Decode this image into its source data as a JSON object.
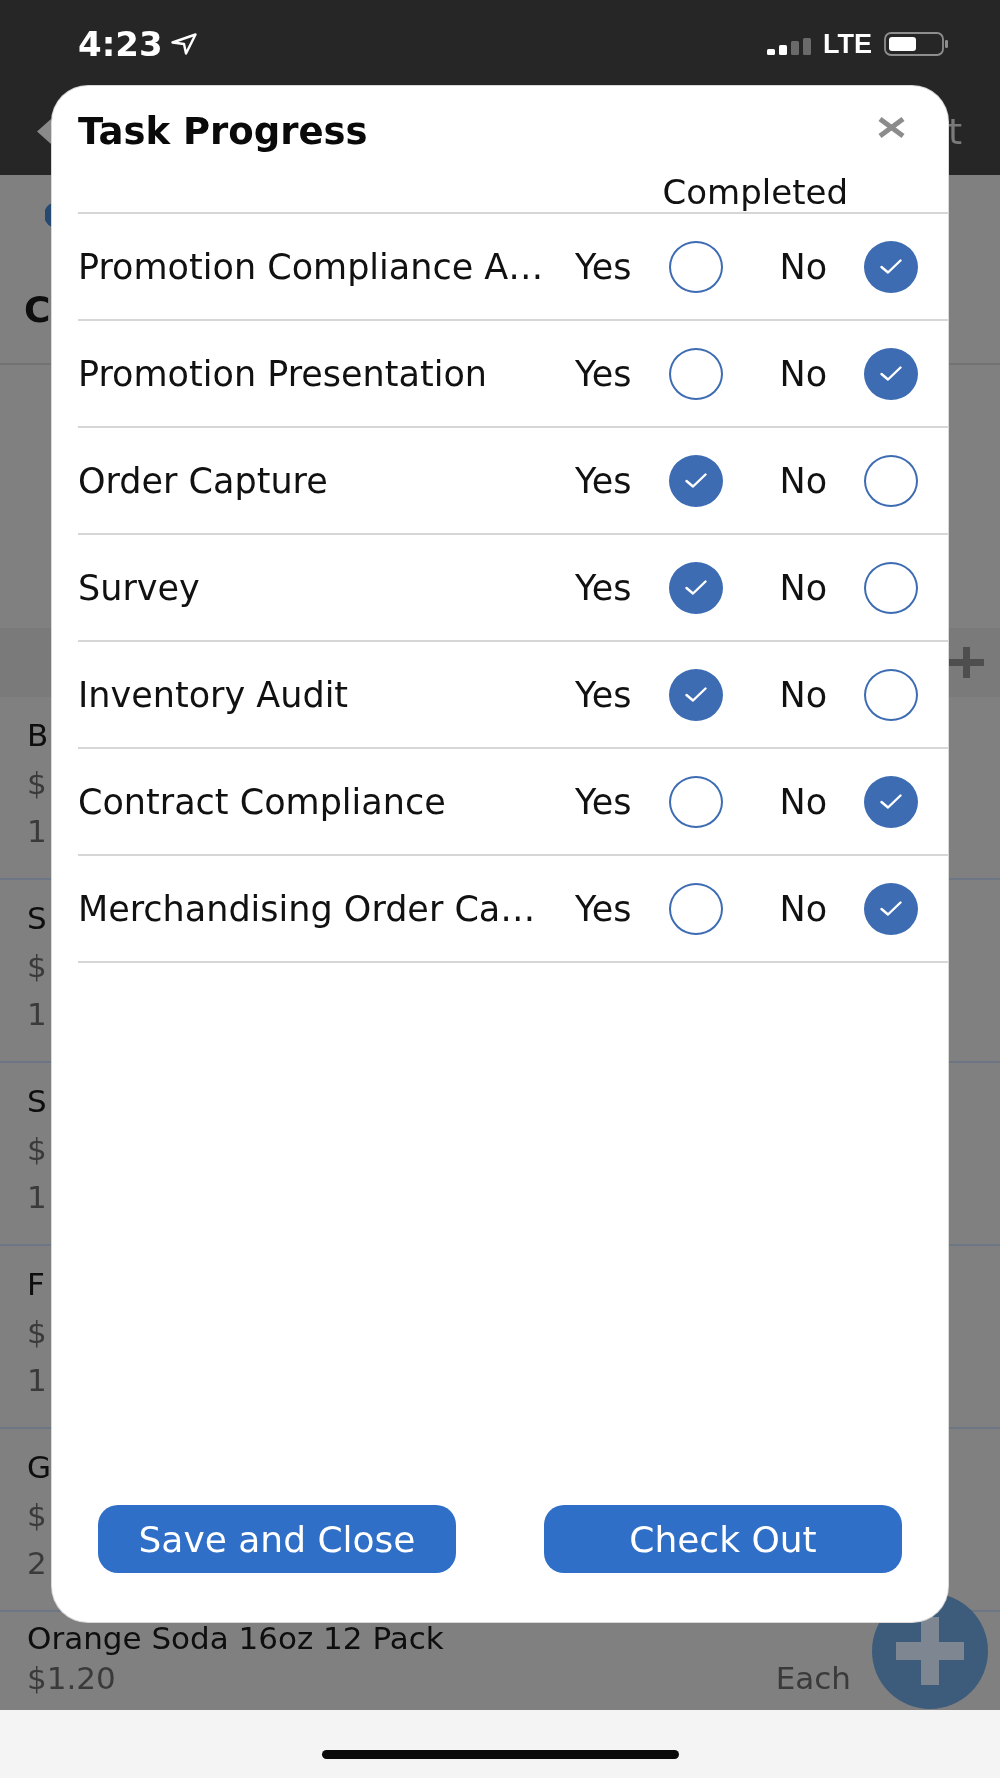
{
  "status_bar": {
    "time": "4:23",
    "network": "LTE"
  },
  "nav_bar": {
    "right_text": "t"
  },
  "background": {
    "heading": "C",
    "items": [
      {
        "name": "B",
        "price": "$",
        "line_3": "1"
      },
      {
        "name": "S",
        "price": "$",
        "line_3": "1"
      },
      {
        "name": "S",
        "price": "$",
        "line_3": "1"
      },
      {
        "name": "F",
        "price": "$",
        "line_3": "1"
      },
      {
        "name": "G",
        "price": "$",
        "line_3": "2"
      },
      {
        "name": "Orange Soda 16oz 12 Pack",
        "price": "$1.20",
        "unit": "Each"
      }
    ]
  },
  "dialog": {
    "title": "Task Progress",
    "column_header": "Completed",
    "tasks": [
      {
        "name": "Promotion Compliance A…",
        "options": [
          {
            "label": "Yes",
            "selected": false
          },
          {
            "label": "No",
            "selected": true
          }
        ]
      },
      {
        "name": "Promotion Presentation",
        "options": [
          {
            "label": "Yes",
            "selected": false
          },
          {
            "label": "No",
            "selected": true
          }
        ]
      },
      {
        "name": "Order Capture",
        "options": [
          {
            "label": "Yes",
            "selected": true
          },
          {
            "label": "No",
            "selected": false
          }
        ]
      },
      {
        "name": "Survey",
        "options": [
          {
            "label": "Yes",
            "selected": true
          },
          {
            "label": "No",
            "selected": false
          }
        ]
      },
      {
        "name": "Inventory Audit",
        "options": [
          {
            "label": "Yes",
            "selected": true
          },
          {
            "label": "No",
            "selected": false
          }
        ]
      },
      {
        "name": "Contract Compliance",
        "options": [
          {
            "label": "Yes",
            "selected": false
          },
          {
            "label": "No",
            "selected": true
          }
        ]
      },
      {
        "name": "Merchandising Order Ca…",
        "options": [
          {
            "label": "Yes",
            "selected": false
          },
          {
            "label": "No",
            "selected": true
          }
        ]
      }
    ],
    "buttons": [
      "Save and Close",
      "Check Out"
    ]
  }
}
